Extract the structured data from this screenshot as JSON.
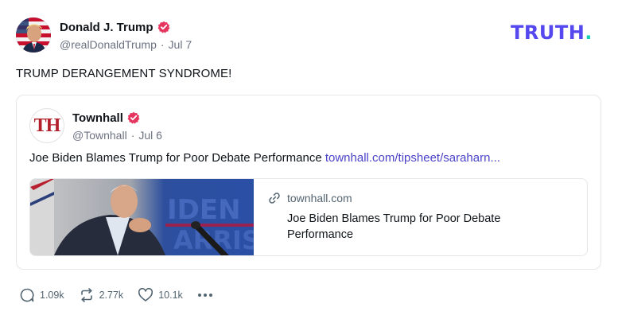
{
  "post": {
    "author_name": "Donald J. Trump",
    "handle": "@realDonaldTrump",
    "separator": "·",
    "date": "Jul 7",
    "text": "TRUMP DERANGEMENT SYNDROME!",
    "avatar_icon": "flag-portrait-avatar",
    "verified_icon": "verified-badge-icon"
  },
  "brand": {
    "logo_text": "TRUTH",
    "logo_dot": ".",
    "logo_color": "#5448ee",
    "dot_color": "#17d1b6"
  },
  "quote": {
    "author_name": "Townhall",
    "avatar_text": "TH",
    "handle": "@Townhall",
    "separator": "·",
    "date": "Jul 6",
    "text": "Joe Biden Blames Trump for Poor Debate Performance ",
    "link_text": "townhall.com/tipsheet/saraharn...",
    "link_color": "#4a43c9",
    "card": {
      "domain": "townhall.com",
      "title": "Joe Biden Blames Trump for Poor Debate Performance",
      "link_icon": "link-icon",
      "thumbnail": "biden-speaking-photo"
    }
  },
  "actions": {
    "replies": "1.09k",
    "retruths": "2.77k",
    "likes": "10.1k",
    "reply_icon": "reply-icon",
    "retruth_icon": "retruth-icon",
    "like_icon": "heart-icon",
    "more_icon": "more-icon"
  },
  "colors": {
    "verified_badge": "#e5345d",
    "townhall_red": "#b11f2a",
    "muted_text": "#6b7280"
  }
}
